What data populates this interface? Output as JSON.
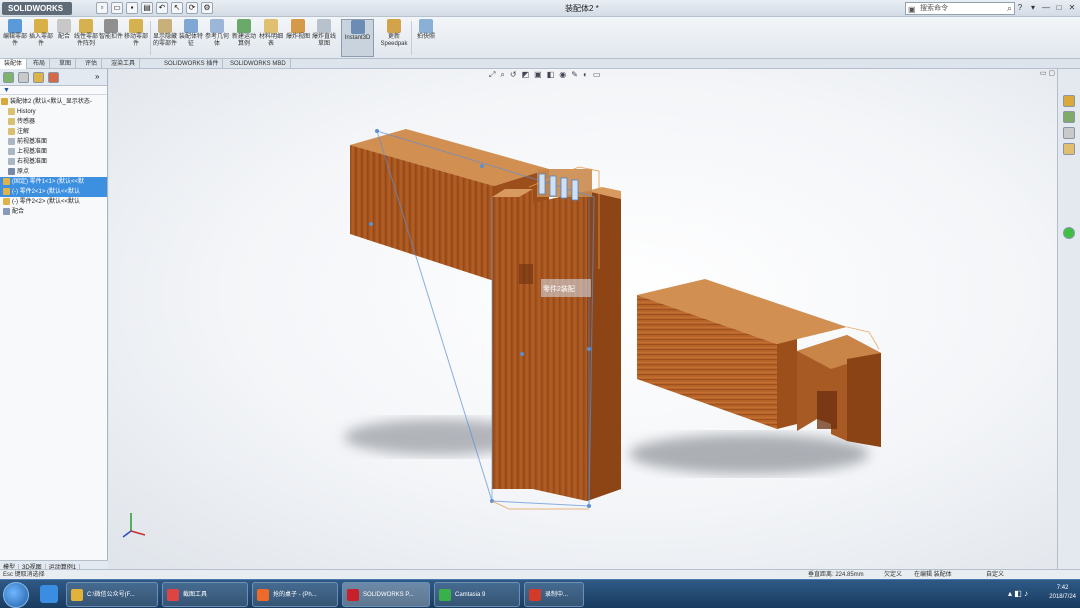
{
  "app": {
    "logo": "SOLIDWORKS",
    "document_title": "装配体2 *",
    "search_placeholder": "搜索命令"
  },
  "window_controls": [
    "?",
    "▾",
    "—",
    "□",
    "✕"
  ],
  "ribbon": [
    {
      "label": "编辑零部件"
    },
    {
      "label": "插入零部件"
    },
    {
      "label": "配合"
    },
    {
      "label": "线性零部件阵列"
    },
    {
      "label": "智能扣件"
    },
    {
      "label": "移动零部件"
    },
    {
      "label": "显示隐藏的零部件"
    },
    {
      "label": "装配体特征"
    },
    {
      "label": "参考几何体"
    },
    {
      "label": "新建运动算例"
    },
    {
      "label": "材料明细表"
    },
    {
      "label": "爆炸视图"
    },
    {
      "label": "爆炸直线草图"
    },
    {
      "label": "Instant3D"
    },
    {
      "label": "更新Speedpak"
    },
    {
      "label": "拍快照"
    }
  ],
  "tabs": [
    "装配体",
    "布局",
    "草图",
    "评估",
    "渲染工具",
    "SOLIDWORKS 插件",
    "SOLIDWORKS MBD"
  ],
  "tree": [
    {
      "label": "装配体2 (默认<默认_显示状态-",
      "sel": false,
      "color": "#d9a93c"
    },
    {
      "label": "History",
      "sel": false,
      "color": "#d8c070"
    },
    {
      "label": "传感器",
      "sel": false,
      "color": "#d8c070"
    },
    {
      "label": "注解",
      "sel": false,
      "color": "#d8c070"
    },
    {
      "label": "前视基准面",
      "sel": false,
      "color": "#aab6c4"
    },
    {
      "label": "上视基准面",
      "sel": false,
      "color": "#aab6c4"
    },
    {
      "label": "右视基准面",
      "sel": false,
      "color": "#aab6c4"
    },
    {
      "label": "原点",
      "sel": false,
      "color": "#7788aa"
    },
    {
      "label": "(固定) 零件1<1> (默认<<默",
      "sel": true,
      "color": "#e0b24a"
    },
    {
      "label": "(-) 零件2<1> (默认<<默认",
      "sel": true,
      "color": "#e0b24a"
    },
    {
      "label": "(-) 零件2<2> (默认<<默认",
      "sel": false,
      "color": "#e0b24a"
    },
    {
      "label": "配合",
      "sel": false,
      "color": "#8899bb"
    }
  ],
  "left_bottom_tabs": [
    "模型",
    "3D视图",
    "运动算例1"
  ],
  "viewport": {
    "instant3d_label": "零件2装配"
  },
  "status": {
    "hint": "Esc 键取消选择",
    "distance": "垂直距离: 224.85mm",
    "status1": "欠定义",
    "status2": "在编辑 装配体",
    "custom": "自定义"
  },
  "taskbar": {
    "items": [
      {
        "label": "C:\\微信公众号(F...",
        "color": "#e2b33a"
      },
      {
        "label": "截图工具",
        "color": "#d44"
      },
      {
        "label": "抢的桌子 - (Ph...",
        "color": "#ee6a2a"
      },
      {
        "label": "SOLIDWORKS P...",
        "color": "#c8202a",
        "active": true
      },
      {
        "label": "Camtasia 9",
        "color": "#3ab04a"
      },
      {
        "label": "录制中...",
        "color": "#d43a2a"
      }
    ],
    "time": "7:42",
    "date": "2018/7/24"
  },
  "colors": {
    "wood_top": "#d28f52",
    "wood_front": "#9c4e1b",
    "wood_side": "#b9672c",
    "selection": "#3d8fe0"
  }
}
